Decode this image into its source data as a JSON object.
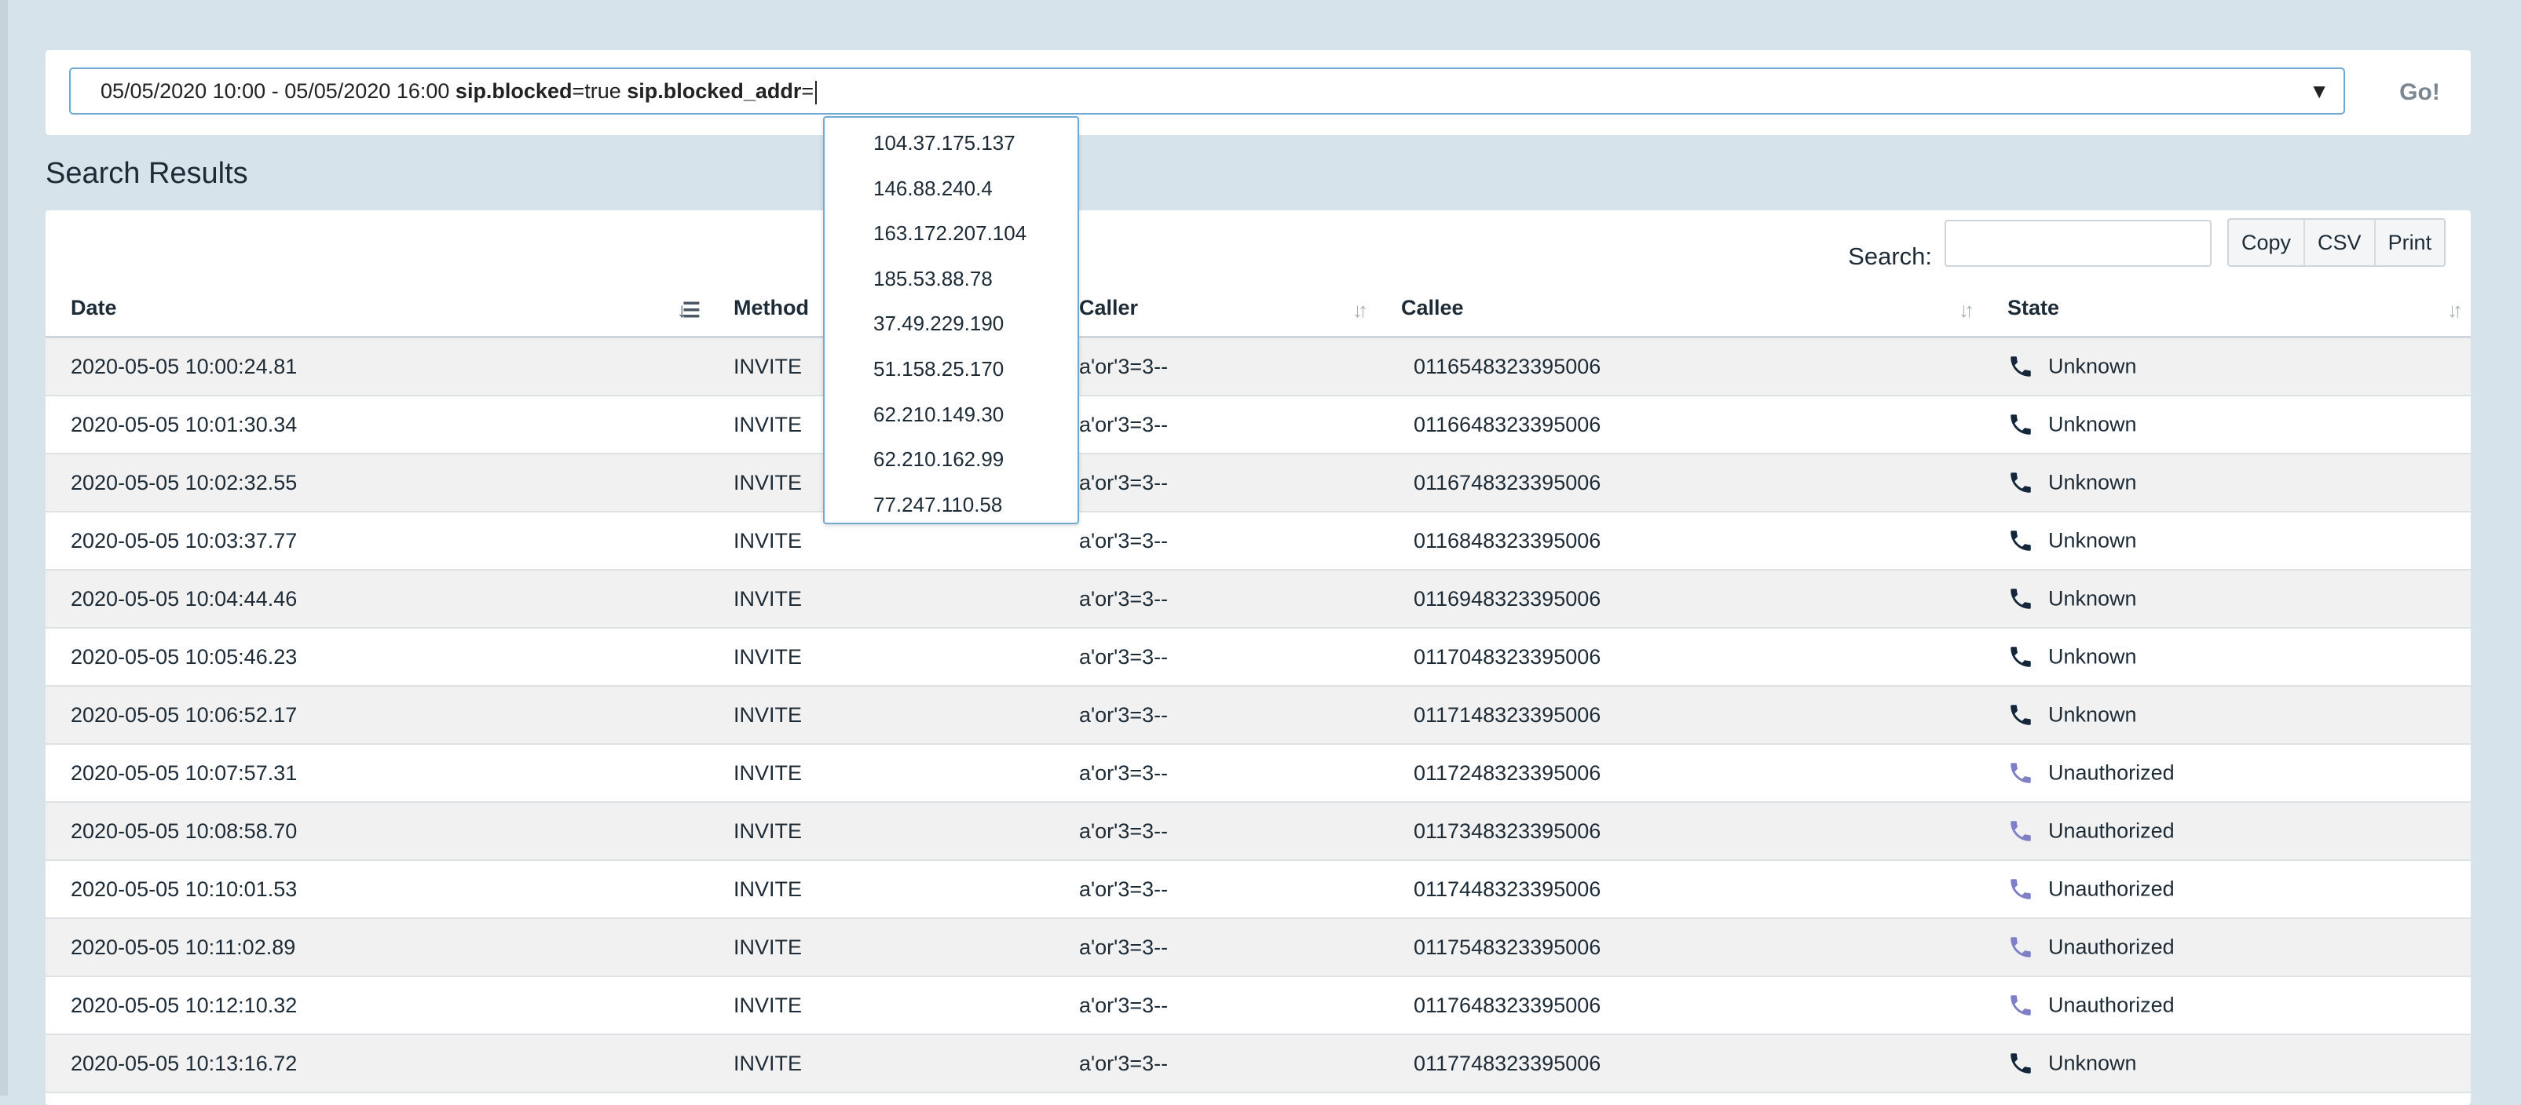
{
  "query": {
    "date_range": "05/05/2020 10:00 - 05/05/2020 16:00",
    "key1": "sip.blocked",
    "value1": "=true",
    "key2": "sip.blocked_addr",
    "value2": "=",
    "go_label": "Go!"
  },
  "autocomplete": {
    "options": [
      "104.37.175.137",
      "146.88.240.4",
      "163.172.207.104",
      "185.53.88.78",
      "37.49.229.190",
      "51.158.25.170",
      "62.210.149.30",
      "62.210.162.99",
      "77.247.110.58"
    ]
  },
  "results": {
    "heading": "Search Results",
    "search_label": "Search:",
    "buttons": [
      "Copy",
      "CSV",
      "Print"
    ],
    "columns": [
      "Date",
      "Method",
      "Caller",
      "Callee",
      "State"
    ],
    "rows": [
      {
        "date": "2020-05-05 10:00:24.81",
        "method": "INVITE",
        "caller": "a'or'3=3--",
        "callee": "0116548323395006",
        "state": "Unknown"
      },
      {
        "date": "2020-05-05 10:01:30.34",
        "method": "INVITE",
        "caller": "a'or'3=3--",
        "callee": "0116648323395006",
        "state": "Unknown"
      },
      {
        "date": "2020-05-05 10:02:32.55",
        "method": "INVITE",
        "caller": "a'or'3=3--",
        "callee": "0116748323395006",
        "state": "Unknown"
      },
      {
        "date": "2020-05-05 10:03:37.77",
        "method": "INVITE",
        "caller": "a'or'3=3--",
        "callee": "0116848323395006",
        "state": "Unknown"
      },
      {
        "date": "2020-05-05 10:04:44.46",
        "method": "INVITE",
        "caller": "a'or'3=3--",
        "callee": "0116948323395006",
        "state": "Unknown"
      },
      {
        "date": "2020-05-05 10:05:46.23",
        "method": "INVITE",
        "caller": "a'or'3=3--",
        "callee": "0117048323395006",
        "state": "Unknown"
      },
      {
        "date": "2020-05-05 10:06:52.17",
        "method": "INVITE",
        "caller": "a'or'3=3--",
        "callee": "0117148323395006",
        "state": "Unknown"
      },
      {
        "date": "2020-05-05 10:07:57.31",
        "method": "INVITE",
        "caller": "a'or'3=3--",
        "callee": "0117248323395006",
        "state": "Unauthorized"
      },
      {
        "date": "2020-05-05 10:08:58.70",
        "method": "INVITE",
        "caller": "a'or'3=3--",
        "callee": "0117348323395006",
        "state": "Unauthorized"
      },
      {
        "date": "2020-05-05 10:10:01.53",
        "method": "INVITE",
        "caller": "a'or'3=3--",
        "callee": "0117448323395006",
        "state": "Unauthorized"
      },
      {
        "date": "2020-05-05 10:11:02.89",
        "method": "INVITE",
        "caller": "a'or'3=3--",
        "callee": "0117548323395006",
        "state": "Unauthorized"
      },
      {
        "date": "2020-05-05 10:12:10.32",
        "method": "INVITE",
        "caller": "a'or'3=3--",
        "callee": "0117648323395006",
        "state": "Unauthorized"
      },
      {
        "date": "2020-05-05 10:13:16.72",
        "method": "INVITE",
        "caller": "a'or'3=3--",
        "callee": "0117748323395006",
        "state": "Unknown"
      }
    ]
  },
  "icons": {
    "state_unknown": "phone-icon-dark",
    "state_unauthorized": "phone-icon-purple",
    "sort": "sort-arrows-icon",
    "dropdown": "caret-down-icon"
  },
  "colors": {
    "unknown_icon": "#13263a",
    "unauthorized_icon": "#7e7fc6",
    "accent_border": "#6fa9d4",
    "page_bg": "#d6e3ea"
  }
}
